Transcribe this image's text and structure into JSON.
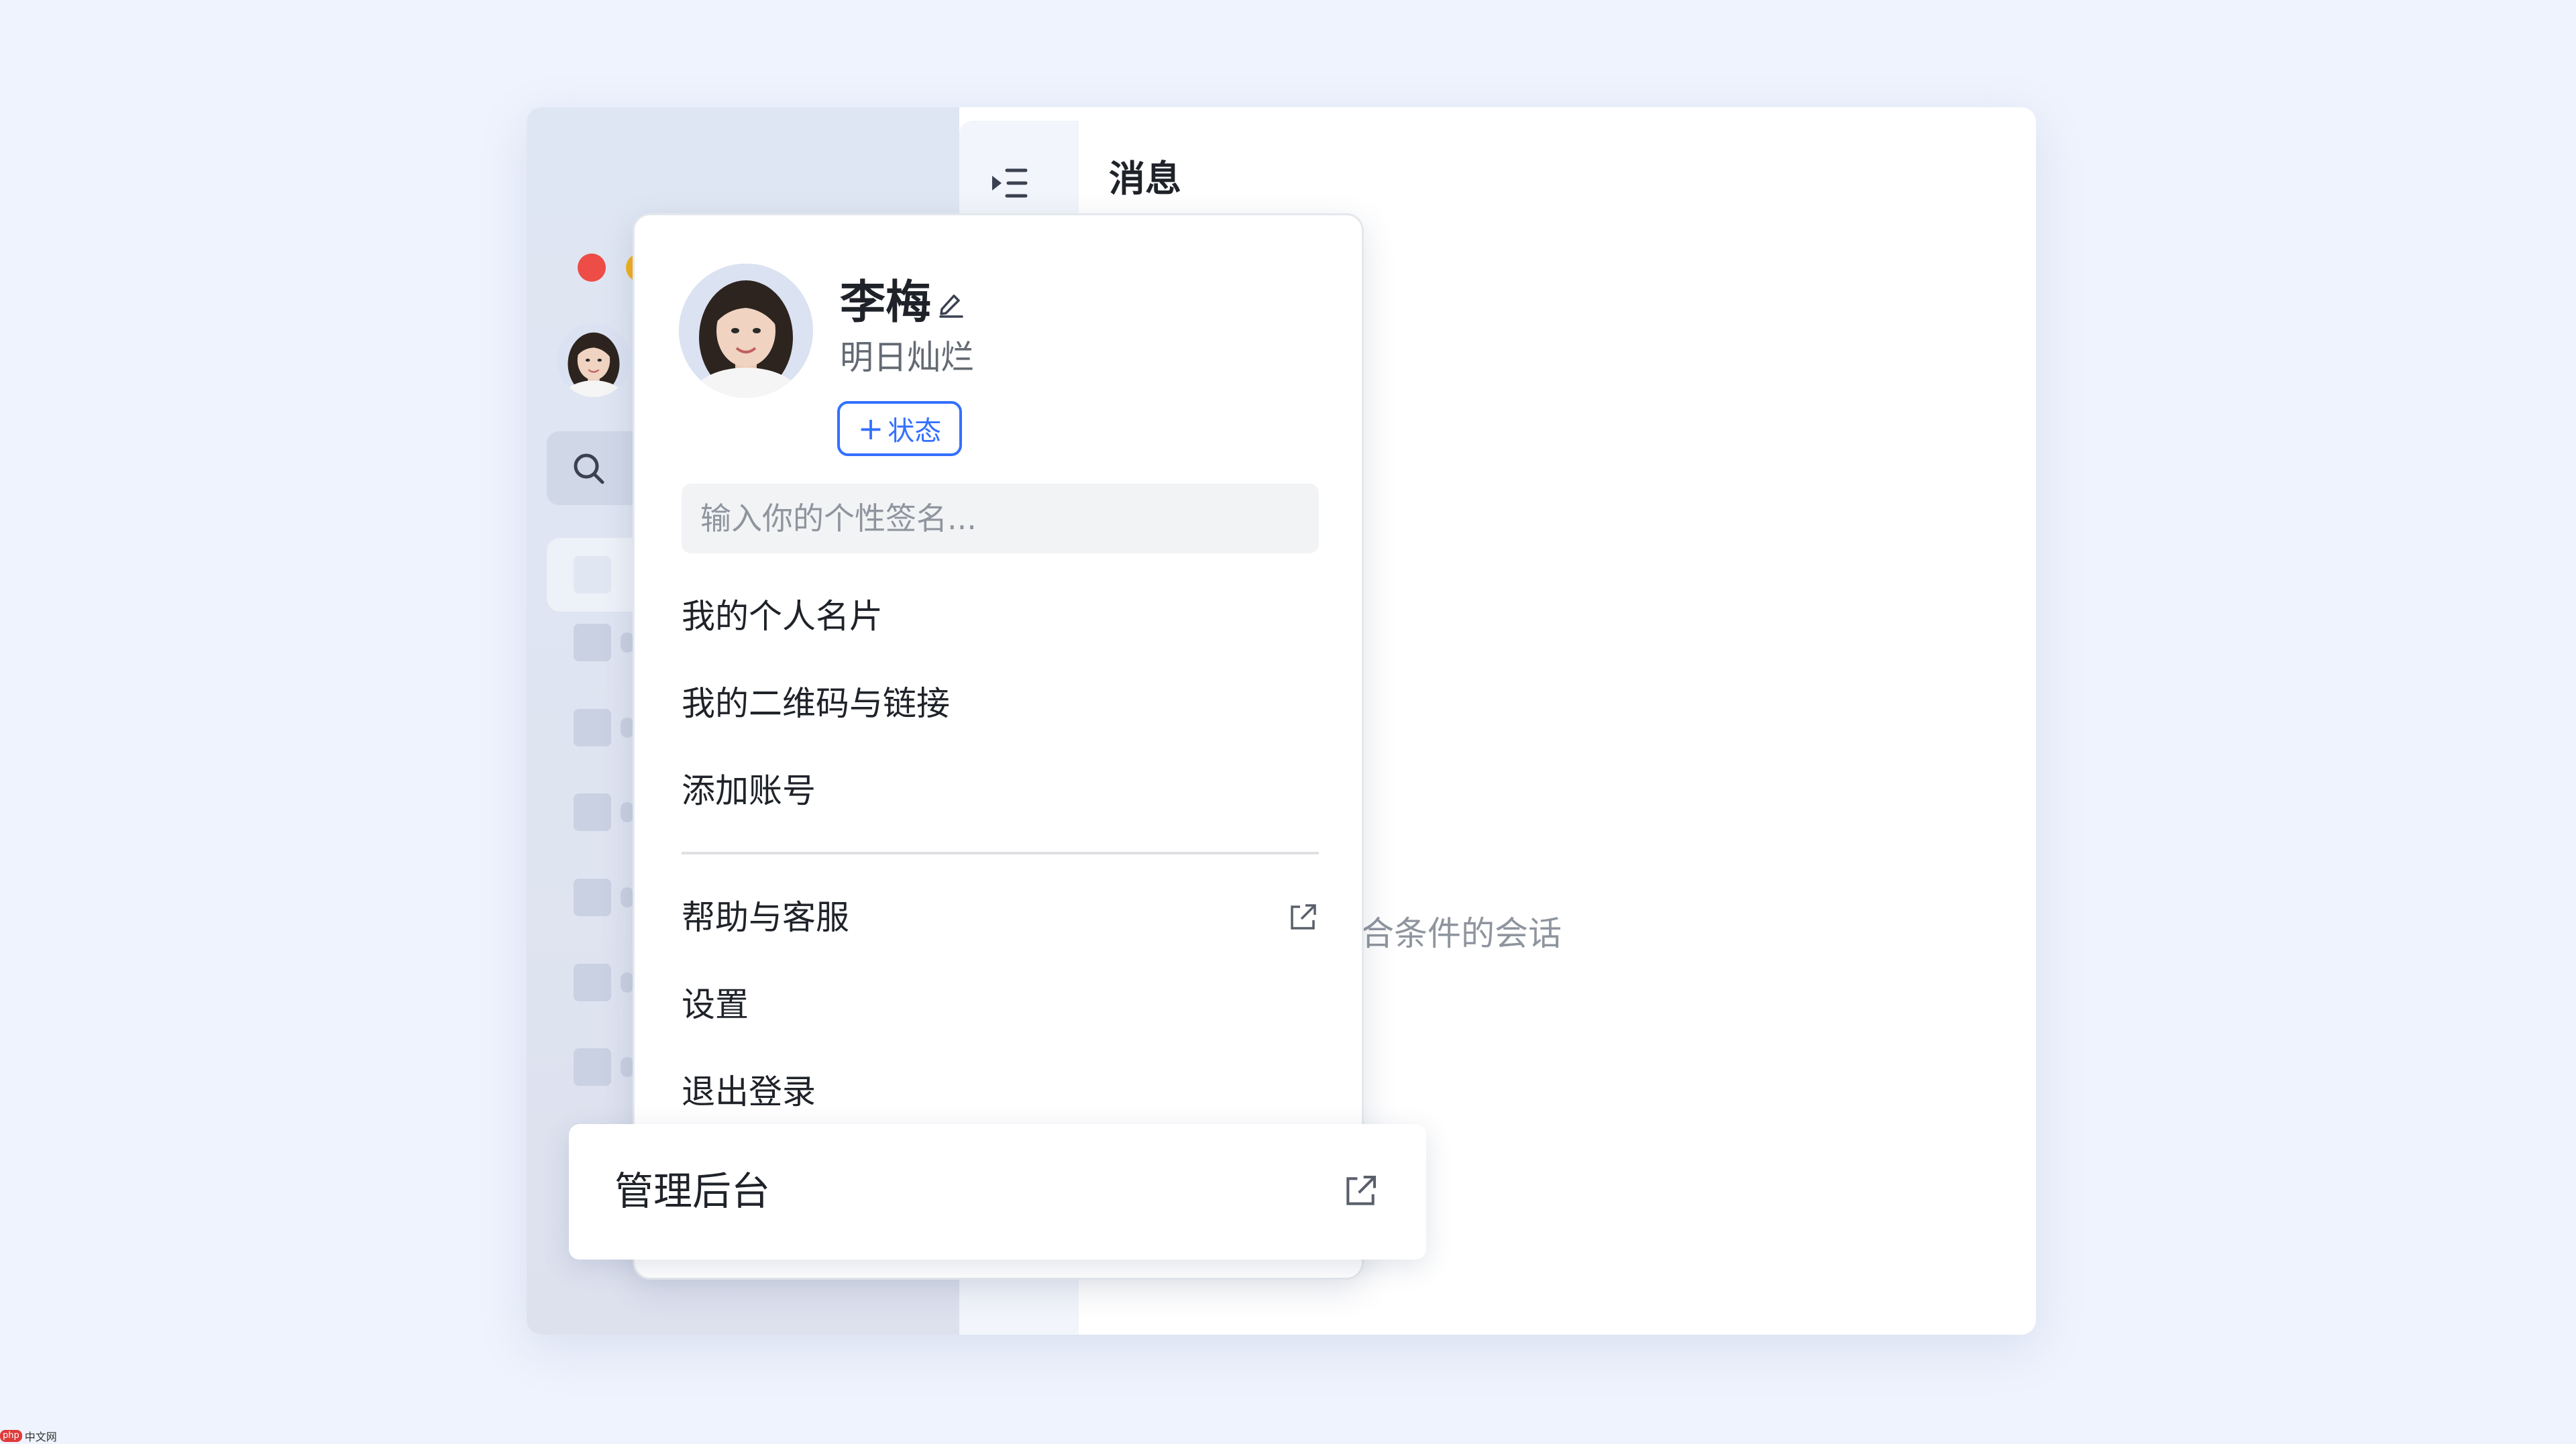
{
  "window": {
    "header_title": "消息",
    "empty_state": "暂无符合条件的会话"
  },
  "sidebar": {
    "avatar_icon": "user-avatar",
    "search_icon": "search-icon",
    "item_count": 8
  },
  "profile": {
    "name": "李梅",
    "subtitle": "明日灿烂",
    "status_button_label": "状态",
    "signature_placeholder": "输入你的个性签名..."
  },
  "menu": {
    "items": [
      {
        "label": "我的个人名片"
      },
      {
        "label": "我的二维码与链接"
      },
      {
        "label": "添加账号"
      },
      {
        "label": "帮助与客服",
        "external": true
      },
      {
        "label": "设置"
      },
      {
        "label": "退出登录"
      }
    ]
  },
  "admin": {
    "label": "管理后台",
    "external": true
  },
  "watermark": {
    "logo": "php",
    "text": "中文网"
  },
  "colors": {
    "accent": "#3370ff",
    "background": "#eef3fd",
    "traffic_red": "#ee4c47",
    "traffic_yellow": "#f3b01c",
    "traffic_green": "#26c13a"
  }
}
